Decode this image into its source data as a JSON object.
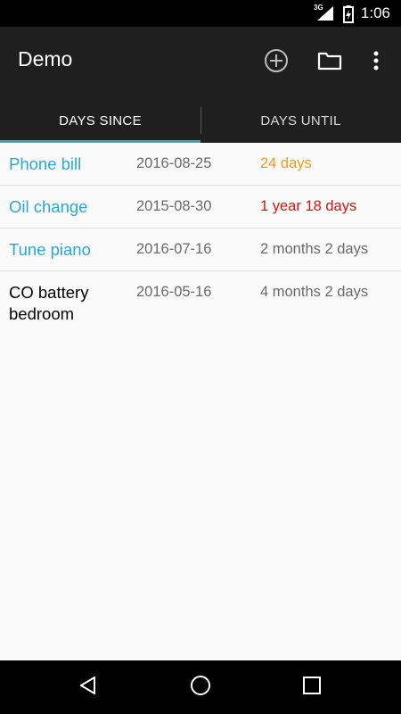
{
  "status_bar": {
    "network": "3G",
    "time": "1:06"
  },
  "app_bar": {
    "title": "Demo",
    "actions": [
      {
        "icon": "add-circle-icon"
      },
      {
        "icon": "folder-icon"
      },
      {
        "icon": "more-vert-icon"
      }
    ]
  },
  "tabs": [
    {
      "label": "DAYS SINCE",
      "selected": true
    },
    {
      "label": "DAYS UNTIL",
      "selected": false
    }
  ],
  "colors": {
    "accent": "#3aa8a8",
    "link": "#29a8d6",
    "orange": "#f39a1a",
    "red": "#e01010",
    "gray": "#6a6a6a",
    "dark": "#000000"
  },
  "items": [
    {
      "name": "Phone bill",
      "date": "2016-08-25",
      "elapsed": "24 days",
      "name_color": "#29a8d6",
      "elapsed_color": "#f39a1a"
    },
    {
      "name": "Oil change",
      "date": "2015-08-30",
      "elapsed": "1 year 18 days",
      "name_color": "#29a8d6",
      "elapsed_color": "#e01010"
    },
    {
      "name": "Tune piano",
      "date": "2016-07-16",
      "elapsed": "2 months 2 days",
      "name_color": "#29a8d6",
      "elapsed_color": "#6a6a6a"
    },
    {
      "name": "CO battery bedroom",
      "date": "2016-05-16",
      "elapsed": "4 months 2 days",
      "name_color": "#000000",
      "elapsed_color": "#6a6a6a"
    }
  ],
  "nav_bar": {
    "buttons": [
      {
        "icon": "back-icon"
      },
      {
        "icon": "home-icon"
      },
      {
        "icon": "recents-icon"
      }
    ]
  }
}
